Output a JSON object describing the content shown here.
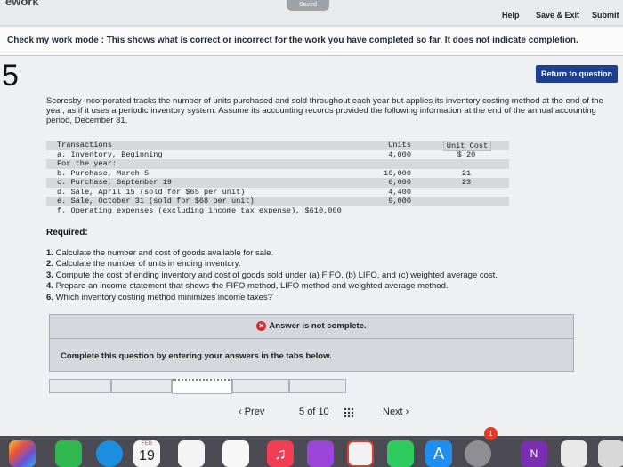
{
  "header": {
    "app_title": "ework",
    "saved": "Saved",
    "help": "Help",
    "save_exit": "Save & Exit",
    "submit": "Submit"
  },
  "banner": {
    "text": "Check my work mode : This shows what is correct or incorrect for the work you have completed so far. It does not indicate completion."
  },
  "question": {
    "number": "5",
    "return_label": "Return to question",
    "intro": "Scoresby Incorporated tracks the number of units purchased and sold throughout each year but applies its inventory costing method at the end of the year, as if it uses a periodic inventory system. Assume its accounting records provided the following information at the end of the annual accounting period, December 31.",
    "table": {
      "header": {
        "label": "Transactions",
        "units": "Units",
        "cost": "Unit Cost"
      },
      "rows": [
        {
          "label": "a. Inventory, Beginning",
          "units": "4,000",
          "cost": "$ 20"
        },
        {
          "label": "For the year:",
          "units": "",
          "cost": ""
        },
        {
          "label": "b. Purchase, March 5",
          "units": "10,000",
          "cost": "21"
        },
        {
          "label": "c. Purchase, September 19",
          "units": "6,000",
          "cost": "23"
        },
        {
          "label": "d. Sale, April 15 (sold for $65 per unit)",
          "units": "4,400",
          "cost": ""
        },
        {
          "label": "e. Sale, October 31 (sold for $68 per unit)",
          "units": "9,000",
          "cost": ""
        },
        {
          "label": "f. Operating expenses (excluding income tax expense), $610,000",
          "units": "",
          "cost": ""
        }
      ]
    },
    "required_label": "Required:",
    "required": [
      {
        "n": "1.",
        "text": "Calculate the number and cost of goods available for sale."
      },
      {
        "n": "2.",
        "text": "Calculate the number of units in ending inventory."
      },
      {
        "n": "3.",
        "text": "Compute the cost of ending inventory and cost of goods sold under (a) FIFO, (b) LIFO, and (c) weighted average cost."
      },
      {
        "n": "4.",
        "text": "Prepare an income statement that shows the FIFO method, LIFO method and weighted average method."
      },
      {
        "n": "6.",
        "text": "Which inventory costing method minimizes income taxes?"
      }
    ]
  },
  "status": {
    "incomplete": "Answer is not complete.",
    "complete_prompt": "Complete this question by entering your answers in the tabs below."
  },
  "pagination": {
    "prev": "‹  Prev",
    "current": "5",
    "of": "of",
    "total": "10",
    "next": "Next  ›"
  },
  "dock": {
    "calendar_month": "FEB",
    "calendar_day": "19",
    "badge": "1"
  }
}
